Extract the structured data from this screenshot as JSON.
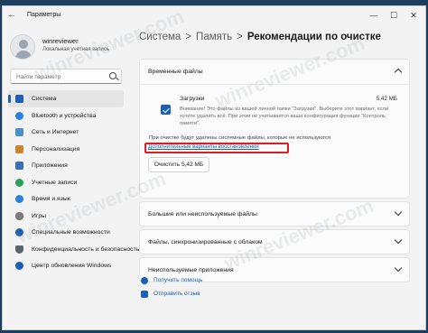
{
  "window": {
    "title": "Параметры",
    "controls": {
      "minimize": "—",
      "maximize": "☐",
      "close": "✕"
    }
  },
  "user": {
    "name": "winreviewer",
    "account_type": "Локальная учетная запись"
  },
  "search": {
    "placeholder": "Найти параметр"
  },
  "sidebar": {
    "items": [
      {
        "label": "Система",
        "icon": "monitor-icon",
        "color": "#1a5fb4",
        "active": true
      },
      {
        "label": "Bluetooth и устройства",
        "icon": "bluetooth-icon",
        "color": "#2a82da"
      },
      {
        "label": "Сеть и Интернет",
        "icon": "network-icon",
        "color": "#4a90c8"
      },
      {
        "label": "Персонализация",
        "icon": "brush-icon",
        "color": "#d0822a"
      },
      {
        "label": "Приложения",
        "icon": "apps-icon",
        "color": "#3a6fb0"
      },
      {
        "label": "Учетные записи",
        "icon": "account-icon",
        "color": "#2aa05a"
      },
      {
        "label": "Время и язык",
        "icon": "globe-icon",
        "color": "#2a82da"
      },
      {
        "label": "Игры",
        "icon": "gamepad-icon",
        "color": "#7a7a7a"
      },
      {
        "label": "Специальные возможности",
        "icon": "accessibility-icon",
        "color": "#1a5fb4"
      },
      {
        "label": "Конфиденциальность и безопасность",
        "icon": "shield-icon",
        "color": "#5a6570"
      },
      {
        "label": "Центр обновления Windows",
        "icon": "update-icon",
        "color": "#1a5fb4"
      }
    ]
  },
  "breadcrumb": {
    "items": [
      "Система",
      "Память",
      "Рекомендации по очистке"
    ],
    "separator": ">"
  },
  "temp_files": {
    "title": "Временные файлы",
    "item": {
      "name": "Загрузки",
      "size": "5,42 МБ",
      "description": "Внимание! Это файлы из вашей личной папки \"Загрузки\". Выберите этот вариант, если хотите удалить всё. При этом не учитывается ваша конфигурация функции \"Контроль памяти\"."
    },
    "note": "При очистке будут удалены системные файлы, которые не используются",
    "restore_link": "Дополнительные варианты восстановления",
    "clean_button": "Очистить 5,42 МБ"
  },
  "sections": [
    {
      "title": "Большие или неиспользуемые файлы"
    },
    {
      "title": "Файлы, синхронизированные с облаком"
    },
    {
      "title": "Неиспользуемые приложения"
    }
  ],
  "footer_links": [
    {
      "label": "Получить помощь",
      "icon": "help-icon"
    },
    {
      "label": "Отправить отзыв",
      "icon": "feedback-icon"
    }
  ],
  "watermark": "winreviewer.com",
  "colors": {
    "accent": "#1a5fb4",
    "highlight": "#e01b24"
  }
}
